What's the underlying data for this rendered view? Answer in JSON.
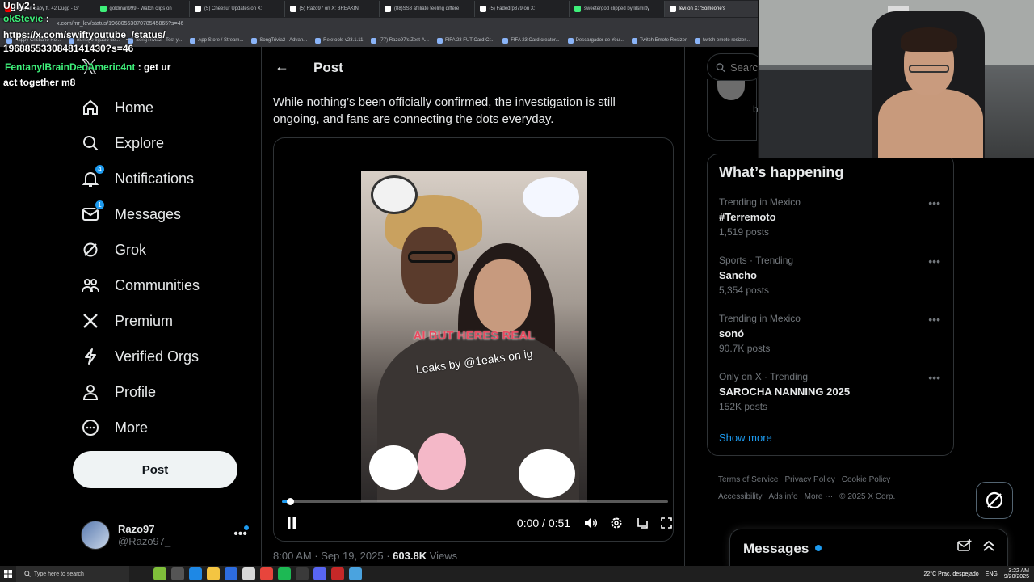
{
  "browser": {
    "tabs": [
      {
        "label": "(148) Lil Baby ft. 42 Dugg - Gr",
        "color": "#ff0000"
      },
      {
        "label": "goldman999 - Watch clips on",
        "color": "#3ef07a"
      },
      {
        "label": "(5) Cheesur Updates on X:",
        "color": "#ffffff"
      },
      {
        "label": "(5) Razo97 on X: BREAKIN",
        "color": "#ffffff"
      },
      {
        "label": "(88)SS8 affiliate feeling differe",
        "color": "#ffffff"
      },
      {
        "label": "(5) Fadedrp879 on X:",
        "color": "#ffffff"
      },
      {
        "label": "sweetergod clipped by lilsmitty",
        "color": "#3ef07a"
      },
      {
        "label": "levi on X: 'Someone's",
        "color": "#ffffff"
      }
    ],
    "url": "x.com/mr_lev/status/1968055307078545865?s=46",
    "bookmarks": [
      "Happy Cristiano Ro...",
      "Buriego Ilgacio de...",
      "SongTrivia2 - Test y...",
      "App Store / Stream...",
      "SongTrivia2 - Advan...",
      "Reletools v23.1.11",
      "(77) Razo97's Zest-A...",
      "FIFA 23 FUT Card Cr...",
      "FIFA 23 Card creator...",
      "Descargador de You...",
      "Twitch Emote Resizer",
      "twitch emote resizer..."
    ]
  },
  "chat": {
    "line0_user": "Ugly2 :",
    "line1_user": "okStevie",
    "line1_colon": " :",
    "line2": "https://x.com/swiftyoutube_/status/",
    "line3": "1968855330848141430?s=46",
    "line4_user": "FentanylBrainDedAmeric4nt",
    "line4_msg": " : get ur",
    "line5": "act together m8"
  },
  "nav": {
    "items": [
      {
        "label": "Home",
        "icon": "home-icon",
        "badge": ""
      },
      {
        "label": "Explore",
        "icon": "search-icon",
        "badge": ""
      },
      {
        "label": "Notifications",
        "icon": "bell-icon",
        "badge": "4"
      },
      {
        "label": "Messages",
        "icon": "envelope-icon",
        "badge": "1"
      },
      {
        "label": "Grok",
        "icon": "grok-icon",
        "badge": ""
      },
      {
        "label": "Communities",
        "icon": "people-icon",
        "badge": ""
      },
      {
        "label": "Premium",
        "icon": "x-logo-icon",
        "badge": ""
      },
      {
        "label": "Verified Orgs",
        "icon": "lightning-icon",
        "badge": ""
      },
      {
        "label": "Profile",
        "icon": "person-icon",
        "badge": ""
      },
      {
        "label": "More",
        "icon": "more-circle-icon",
        "badge": ""
      }
    ],
    "post_button": "Post"
  },
  "account": {
    "name": "Razo97",
    "handle": "@Razo97_",
    "more": "•••"
  },
  "main": {
    "title": "Post",
    "tweet_text": "While nothing’s been officially confirmed, the investigation is still ongoing, and fans are connecting the dots everyday.",
    "video": {
      "overlay_red": "AI BUT HERES REAL",
      "overlay_white": "Leaks by @1eaks on ig",
      "time": "0:00 / 0:51",
      "progress": 0.02
    },
    "meta_time": "8:00 AM · Sep 19, 2025 · ",
    "meta_views": "603.8K",
    "meta_views_label": " Views"
  },
  "right": {
    "search_placeholder": "Search",
    "top_partial": "b",
    "whats_happening": "What’s happening",
    "trends": [
      {
        "context": "Trending in Mexico",
        "name": "#Terremoto",
        "count": "1,519 posts"
      },
      {
        "context": "Sports · Trending",
        "name": "Sancho",
        "count": "5,354 posts"
      },
      {
        "context": "Trending in Mexico",
        "name": "sonó",
        "count": "90.7K posts"
      },
      {
        "context": "Only on X · Trending",
        "name": "SAROCHA NANNING 2025",
        "count": "152K posts"
      }
    ],
    "show_more": "Show more",
    "footer": [
      "Terms of Service",
      "Privacy Policy",
      "Cookie Policy",
      "Accessibility",
      "Ads info",
      "More ···",
      "© 2025 X Corp."
    ]
  },
  "messages_drawer": {
    "title": "Messages"
  },
  "taskbar": {
    "search": "Type here to search",
    "weather": "22°C  Prac. despejado",
    "lang": "ENG",
    "time": "3:22 AM",
    "date": "9/20/2025"
  }
}
